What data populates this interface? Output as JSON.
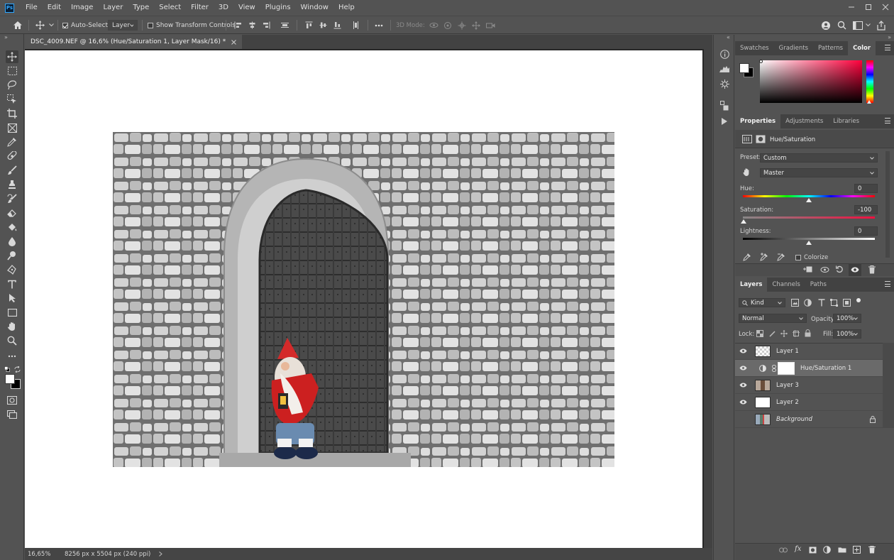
{
  "app": {
    "logo": "Ps"
  },
  "menu": [
    "File",
    "Edit",
    "Image",
    "Layer",
    "Type",
    "Select",
    "Filter",
    "3D",
    "View",
    "Plugins",
    "Window",
    "Help"
  ],
  "options": {
    "auto_select_label": "Auto-Select:",
    "auto_select_checked": true,
    "auto_select_value": "Layer",
    "show_transform_label": "Show Transform Controls",
    "mode_3d_label": "3D Mode:"
  },
  "document": {
    "tab_title": "DSC_4009.NEF @ 16,6% (Hue/Saturation 1, Layer Mask/16) *",
    "zoom": "16,65%",
    "dimensions": "8256 px x 5504 px (240 ppi)"
  },
  "color_panel": {
    "tabs": [
      "Swatches",
      "Gradients",
      "Patterns",
      "Color"
    ],
    "active_tab": "Color",
    "foreground": "#ffffff",
    "background": "#000000",
    "hue_base": "#ff003c"
  },
  "properties_panel": {
    "tabs": [
      "Properties",
      "Adjustments",
      "Libraries"
    ],
    "active_tab": "Properties",
    "title": "Hue/Saturation",
    "preset_label": "Preset:",
    "preset_value": "Custom",
    "channel_value": "Master",
    "hue_label": "Hue:",
    "hue_value": "0",
    "saturation_label": "Saturation:",
    "saturation_value": "-100",
    "lightness_label": "Lightness:",
    "lightness_value": "0",
    "colorize_label": "Colorize",
    "colorize_checked": false
  },
  "layers_panel": {
    "tabs": [
      "Layers",
      "Channels",
      "Paths"
    ],
    "active_tab": "Layers",
    "filter_kind": "Kind",
    "blend_mode": "Normal",
    "opacity_label": "Opacity:",
    "opacity_value": "100%",
    "lock_label": "Lock:",
    "fill_label": "Fill:",
    "fill_value": "100%",
    "layers": [
      {
        "name": "Layer 1",
        "visible": true,
        "selected": false,
        "thumb": "transparent"
      },
      {
        "name": "Hue/Saturation 1",
        "visible": true,
        "selected": true,
        "thumb": "adjustment"
      },
      {
        "name": "Layer 3",
        "visible": true,
        "selected": false,
        "thumb": "photo"
      },
      {
        "name": "Layer 2",
        "visible": true,
        "selected": false,
        "thumb": "white"
      },
      {
        "name": "Background",
        "visible": false,
        "selected": false,
        "thumb": "photo-color",
        "locked": true
      }
    ]
  }
}
